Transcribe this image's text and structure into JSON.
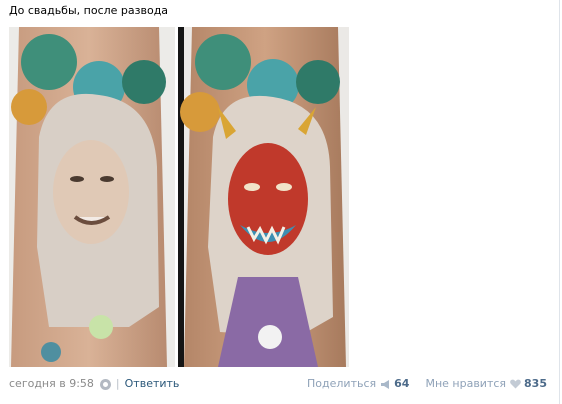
{
  "post": {
    "text": "До свадьбы, после развода"
  },
  "photos": {
    "left": {
      "icon": "tattoo-portrait-woman"
    },
    "right": {
      "icon": "tattoo-oni-mask"
    }
  },
  "footer": {
    "timestamp": "сегодня в 9:58",
    "separator": "|",
    "reply_label": "Ответить",
    "share_label": "Поделиться",
    "share_count": "64",
    "like_label": "Мне нравится",
    "like_count": "835"
  },
  "colors": {
    "link": "#2b587a",
    "muted": "#8a8a8a",
    "counter": "#4d6b8a"
  }
}
